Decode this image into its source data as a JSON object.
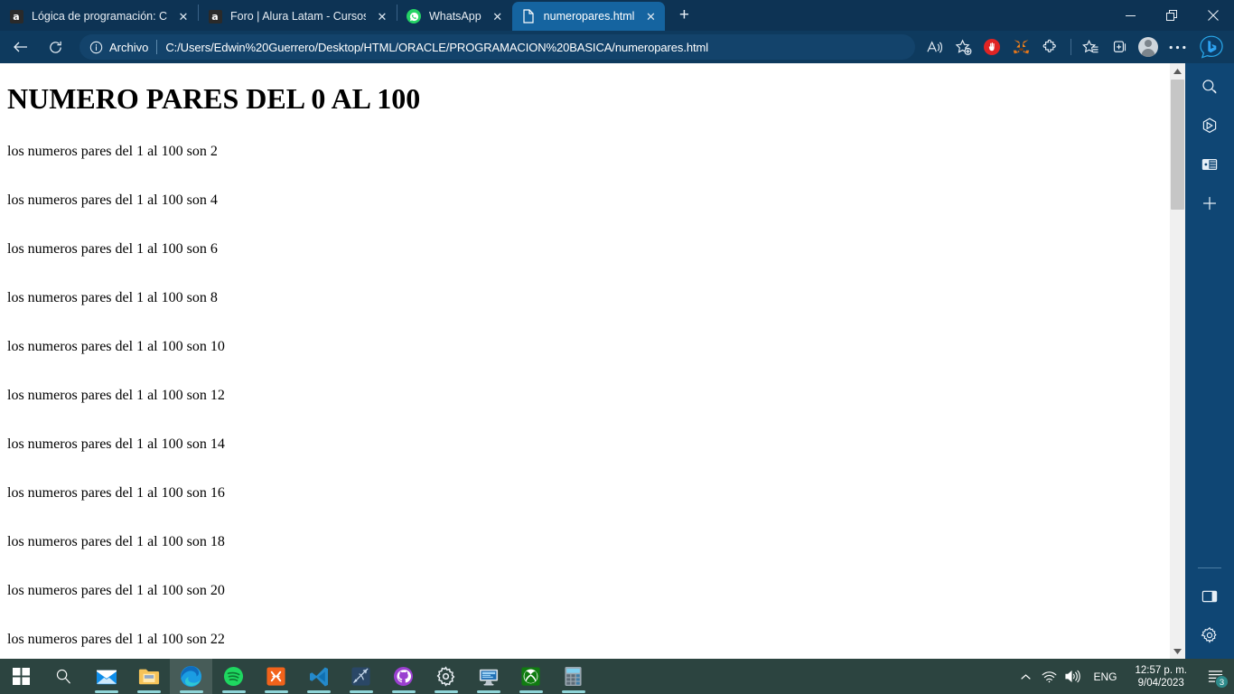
{
  "browser": {
    "tabs": [
      {
        "title": "Lógica de programación: Concep",
        "favicon": "alura-icon",
        "active": false
      },
      {
        "title": "Foro | Alura Latam - Cursos onlin",
        "favicon": "alura-icon",
        "active": false
      },
      {
        "title": "WhatsApp",
        "favicon": "whatsapp-icon",
        "active": false
      },
      {
        "title": "numeropares.html",
        "favicon": "document-icon",
        "active": true
      }
    ],
    "new_tab_label": "+",
    "window_controls": {
      "minimize": "—",
      "restore": "❐",
      "close": "✕"
    },
    "nav": {
      "back": "←",
      "refresh": "↻",
      "scheme_label": "Archivo",
      "url": "C:/Users/Edwin%20Guerrero/Desktop/HTML/ORACLE/PROGRAMACION%20BASICA/numeropares.html"
    },
    "toolbar_icons": [
      "read-aloud-icon",
      "add-favorite-icon",
      "adblock-icon",
      "metamask-fox-icon",
      "extensions-puzzle-icon",
      "favorites-list-icon",
      "collections-icon",
      "profile-avatar-icon",
      "more-options-icon"
    ],
    "bing_chat_icon": "bing-copilot-icon",
    "sidebar_icons": [
      "search-icon",
      "bing-discover-icon",
      "outlook-icon",
      "add-sidebar-app-icon"
    ],
    "sidebar_bottom_icons": [
      "split-screen-icon",
      "settings-gear-icon"
    ]
  },
  "page": {
    "heading": "NUMERO PARES DEL 0 AL 100",
    "lines": [
      "los numeros pares del 1 al 100 son 2",
      "los numeros pares del 1 al 100 son 4",
      "los numeros pares del 1 al 100 son 6",
      "los numeros pares del 1 al 100 son 8",
      "los numeros pares del 1 al 100 son 10",
      "los numeros pares del 1 al 100 son 12",
      "los numeros pares del 1 al 100 son 14",
      "los numeros pares del 1 al 100 son 16",
      "los numeros pares del 1 al 100 son 18",
      "los numeros pares del 1 al 100 son 20",
      "los numeros pares del 1 al 100 son 22"
    ]
  },
  "taskbar": {
    "apps": [
      "windows-start-icon",
      "search-icon",
      "mail-icon",
      "file-explorer-icon",
      "microsoft-edge-icon",
      "spotify-icon",
      "xampp-icon",
      "vscode-icon",
      "pen-tool-icon",
      "github-icon",
      "settings-gear-icon",
      "remote-desktop-icon",
      "xbox-icon",
      "calculator-icon"
    ],
    "tray": {
      "show_hidden_icons": "show-hidden-icons-chevron",
      "network": "wifi-icon",
      "volume": "volume-icon",
      "language": "ENG",
      "time": "12:57 p. m.",
      "date": "9/04/2023",
      "notification_count": "3"
    }
  }
}
